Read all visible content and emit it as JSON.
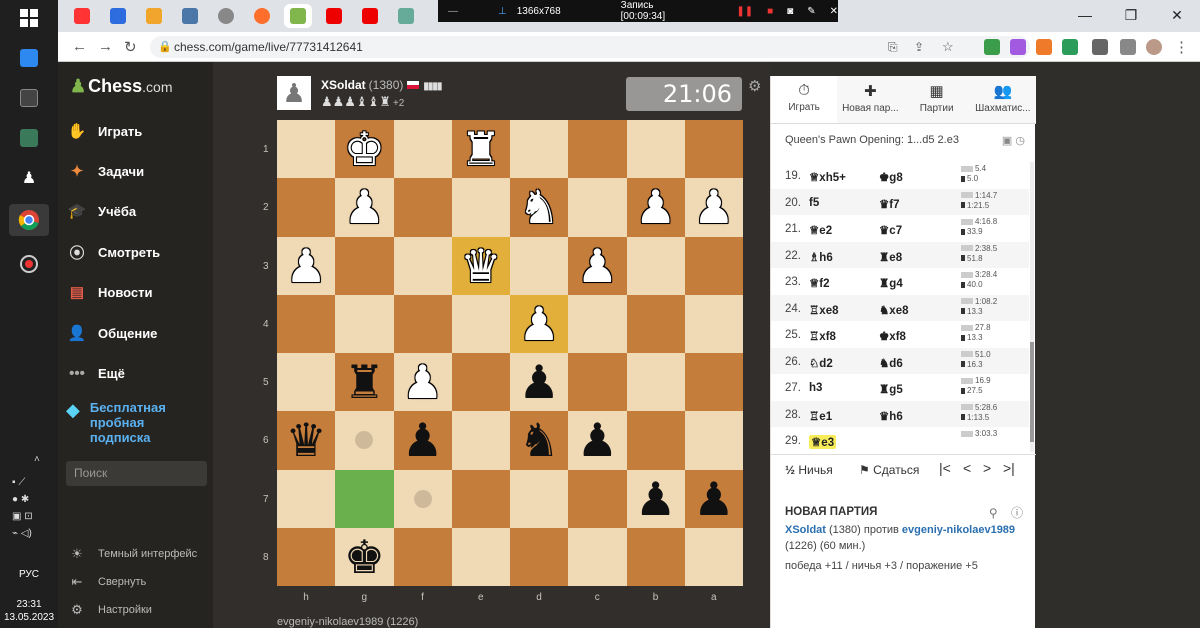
{
  "taskbar": {
    "lang": "РУС",
    "time": "23:31",
    "date": "13.05.2023"
  },
  "recorder": {
    "resolution": "1366x768",
    "status": "Запись [00:09:34]"
  },
  "browser": {
    "url": "chess.com/game/live/77731412641"
  },
  "sidebar": {
    "logo_main": "Chess",
    "logo_suffix": ".com",
    "items": [
      {
        "label": "Играть"
      },
      {
        "label": "Задачи"
      },
      {
        "label": "Учёба"
      },
      {
        "label": "Смотреть"
      },
      {
        "label": "Новости"
      },
      {
        "label": "Общение"
      },
      {
        "label": "Ещё"
      }
    ],
    "promo": "Бесплатная пробная подписка",
    "search_placeholder": "Поиск",
    "bottom": [
      {
        "label": "Темный интерфейс"
      },
      {
        "label": "Свернуть"
      },
      {
        "label": "Настройки"
      }
    ]
  },
  "top_player": {
    "name": "XSoldat",
    "rating": "(1380)",
    "captured": "♟♟♟♝♝♜",
    "advantage": "+2",
    "clock": "21:06"
  },
  "bottom_player": {
    "name": "evgeniy-nikolaev1989",
    "rating": "(1226)"
  },
  "board": {
    "ranks": [
      "1",
      "2",
      "3",
      "4",
      "5",
      "6",
      "7",
      "8"
    ],
    "files": [
      "h",
      "g",
      "f",
      "e",
      "d",
      "c",
      "b",
      "a"
    ],
    "rows": [
      [
        "",
        "wK",
        "",
        "wR",
        "",
        "",
        "",
        ""
      ],
      [
        "",
        "wP",
        "",
        "",
        "wN",
        "",
        "wP",
        "wP"
      ],
      [
        "wP",
        "",
        "",
        "wQ",
        "",
        "wP",
        "",
        ""
      ],
      [
        "",
        "",
        "",
        "",
        "wP",
        "",
        "",
        ""
      ],
      [
        "",
        "bR",
        "wP",
        "",
        "bP",
        "",
        "",
        ""
      ],
      [
        "bQ",
        "",
        "bP",
        "",
        "bN",
        "bP",
        "",
        ""
      ],
      [
        "",
        "",
        "",
        "",
        "",
        "",
        "bP",
        "bP"
      ],
      [
        "",
        "bK",
        "",
        "",
        "",
        "",
        "",
        ""
      ]
    ],
    "highlights": [
      "2-3",
      "3-4"
    ],
    "move_square": "6-1",
    "dots": [
      "5-1",
      "6-2",
      "7-1"
    ]
  },
  "panel": {
    "tabs": [
      {
        "icon": "⏱",
        "label": "Играть"
      },
      {
        "icon": "✚",
        "label": "Новая пар..."
      },
      {
        "icon": "▦",
        "label": "Партии"
      },
      {
        "icon": "👥",
        "label": "Шахматис..."
      }
    ],
    "opening": "Queen's Pawn Opening: 1...d5 2.e3",
    "moves": [
      {
        "no": "19.",
        "white": "♕xh5+",
        "black": "♚g8",
        "tw": "5.4",
        "tb": "5.0"
      },
      {
        "no": "20.",
        "white": "f5",
        "black": "♛f7",
        "tw": "1:14.7",
        "tb": "1:21.5"
      },
      {
        "no": "21.",
        "white": "♕e2",
        "black": "♛c7",
        "tw": "4:16.8",
        "tb": "33.9"
      },
      {
        "no": "22.",
        "white": "♗h6",
        "black": "♜e8",
        "tw": "2:38.5",
        "tb": "51.8"
      },
      {
        "no": "23.",
        "white": "♕f2",
        "black": "♜g4",
        "tw": "3:28.4",
        "tb": "40.0"
      },
      {
        "no": "24.",
        "white": "♖xe8",
        "black": "♞xe8",
        "tw": "1:08.2",
        "tb": "13.3"
      },
      {
        "no": "25.",
        "white": "♖xf8",
        "black": "♚xf8",
        "tw": "27.8",
        "tb": "13.3"
      },
      {
        "no": "26.",
        "white": "♘d2",
        "black": "♞d6",
        "tw": "51.0",
        "tb": "16.3"
      },
      {
        "no": "27.",
        "white": "h3",
        "black": "♜g5",
        "tw": "16.9",
        "tb": "27.5"
      },
      {
        "no": "28.",
        "white": "♖e1",
        "black": "♛h6",
        "tw": "5:28.6",
        "tb": "1:13.5"
      },
      {
        "no": "29.",
        "white": "♕e3",
        "black": "",
        "tw": "3:03.3",
        "tb": ""
      }
    ],
    "draw_label": "Ничья",
    "draw_icon": "½",
    "resign_label": "Сдаться",
    "newgame": {
      "heading": "НОВАЯ ПАРТИЯ",
      "p1": "XSoldat",
      "p1_rating": "(1380)",
      "vs": "против",
      "p2": "evgeniy-nikolaev1989",
      "p2_rating": "(1226)",
      "time_control": "(60 мин.)",
      "stats": "победа +11 / ничья +3 / поражение +5"
    }
  },
  "colors": {
    "light_square": "#f0d9b5",
    "dark_square": "#c57d3b",
    "highlight": "#f5c43a",
    "sidebar": "#262421",
    "accent_green": "#81b64c"
  }
}
